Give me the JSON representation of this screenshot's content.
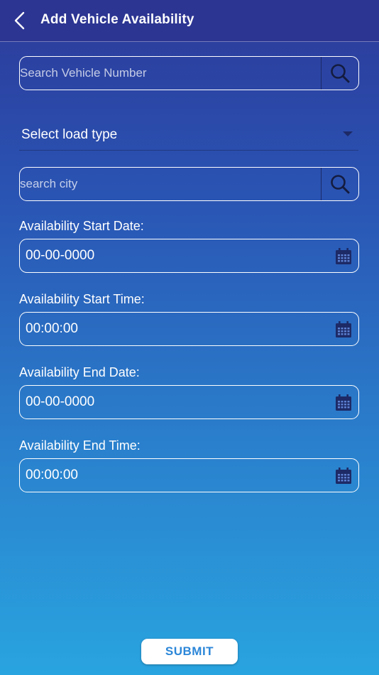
{
  "header": {
    "title": "Add Vehicle Availability"
  },
  "vehicle_search": {
    "placeholder": "Search Vehicle Number",
    "value": ""
  },
  "load_type": {
    "selected_label": "Select load type"
  },
  "city_search": {
    "placeholder": "search city",
    "value": ""
  },
  "fields": {
    "start_date": {
      "label": "Availability Start Date:",
      "value": "00-00-0000"
    },
    "start_time": {
      "label": "Availability Start Time:",
      "value": "00:00:00"
    },
    "end_date": {
      "label": "Availability End Date:",
      "value": "00-00-0000"
    },
    "end_time": {
      "label": "Availability End Time:",
      "value": "00:00:00"
    }
  },
  "submit": {
    "label": "SUBMIT"
  },
  "icons": {
    "back": "chevron-left-icon",
    "search": "search-icon",
    "dropdown": "caret-down-icon",
    "calendar": "calendar-icon"
  },
  "colors": {
    "header_bg": "#2c3592",
    "gradient_top": "#2c3a9a",
    "gradient_bottom": "#29a4e0",
    "submit_text": "#2b86d8",
    "icon_dark": "#1d2a66"
  }
}
